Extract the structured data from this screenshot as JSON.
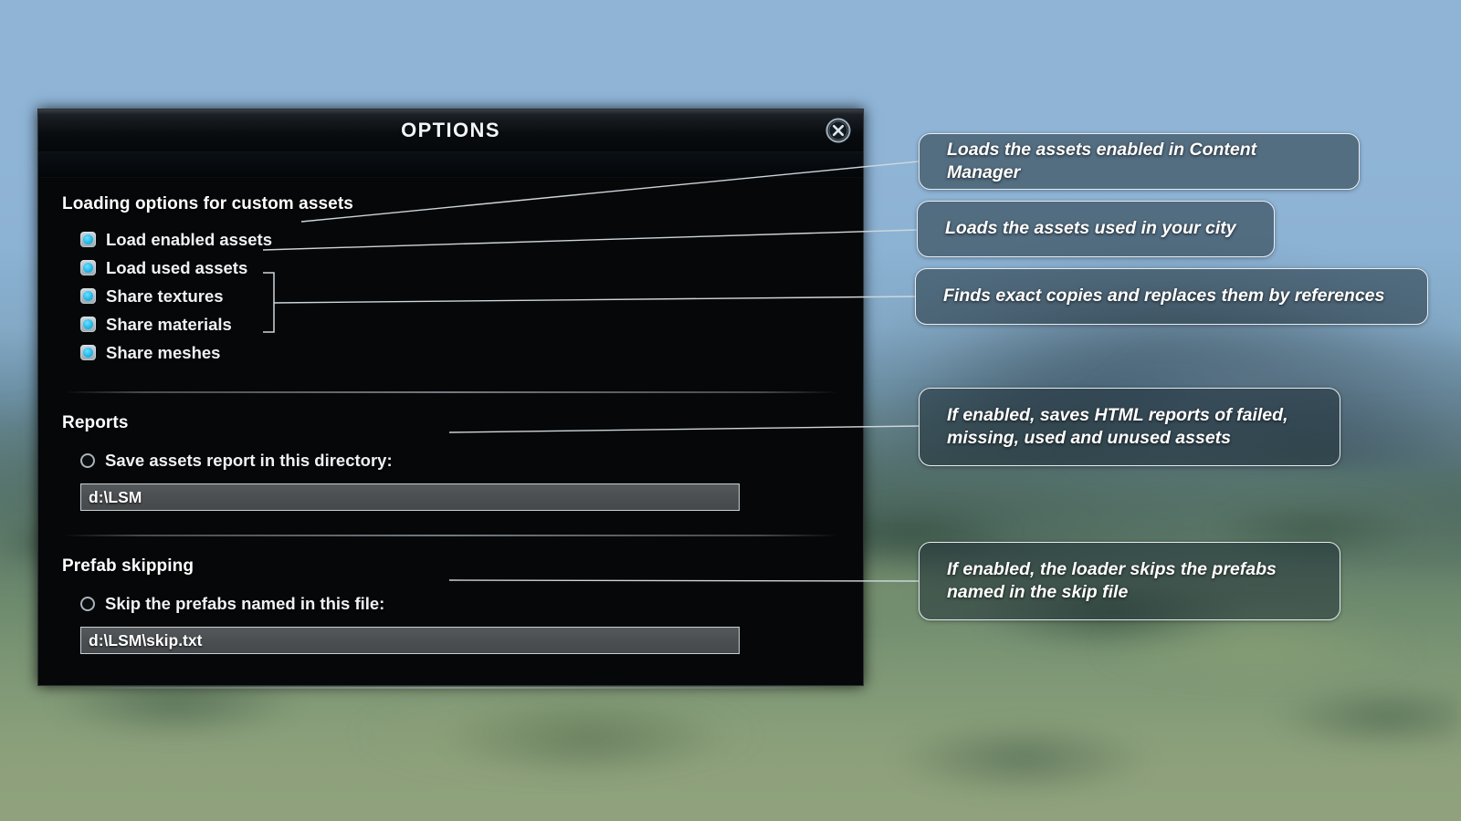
{
  "window": {
    "title": "OPTIONS",
    "close_icon": "close-circle-icon"
  },
  "sections": {
    "loading": {
      "heading": "Loading options for custom assets",
      "options": [
        {
          "label": "Load enabled assets",
          "state": "checked"
        },
        {
          "label": "Load used assets",
          "state": "checked"
        },
        {
          "label": "Share textures",
          "state": "checked"
        },
        {
          "label": "Share materials",
          "state": "checked"
        },
        {
          "label": "Share meshes",
          "state": "checked"
        }
      ]
    },
    "reports": {
      "heading": "Reports",
      "option": {
        "label": "Save assets report in this directory:",
        "state": "unchecked"
      },
      "field": {
        "value": "d:\\LSM",
        "placeholder": "d:\\LSM"
      }
    },
    "prefab": {
      "heading": "Prefab skipping",
      "option": {
        "label": "Skip the prefabs named in this file:",
        "state": "unchecked"
      },
      "field": {
        "value": "d:\\LSM\\skip.txt",
        "placeholder": "d:\\LSM\\skip.txt"
      }
    }
  },
  "callouts": [
    {
      "id": "callout-load-enabled",
      "line1": "Loads the assets  enabled in Content Manager",
      "line2": ""
    },
    {
      "id": "callout-load-used",
      "line1": "Loads the assets  used in your city",
      "line2": ""
    },
    {
      "id": "callout-share",
      "line1": "Finds exact copies and replaces them by references",
      "line2": ""
    },
    {
      "id": "callout-reports",
      "line1": "If enabled, saves  HTML reports of failed,",
      "line2": "missing,  used and unused  assets"
    },
    {
      "id": "callout-prefab",
      "line1": "If enabled, the loader skips the prefabs",
      "line2": "named in the skip file"
    }
  ],
  "colors": {
    "checkbox_accent": "#24b9e8",
    "callout_border": "#e8eef2",
    "window_bg": "#060708",
    "leader_line": "#cdd6dc"
  }
}
